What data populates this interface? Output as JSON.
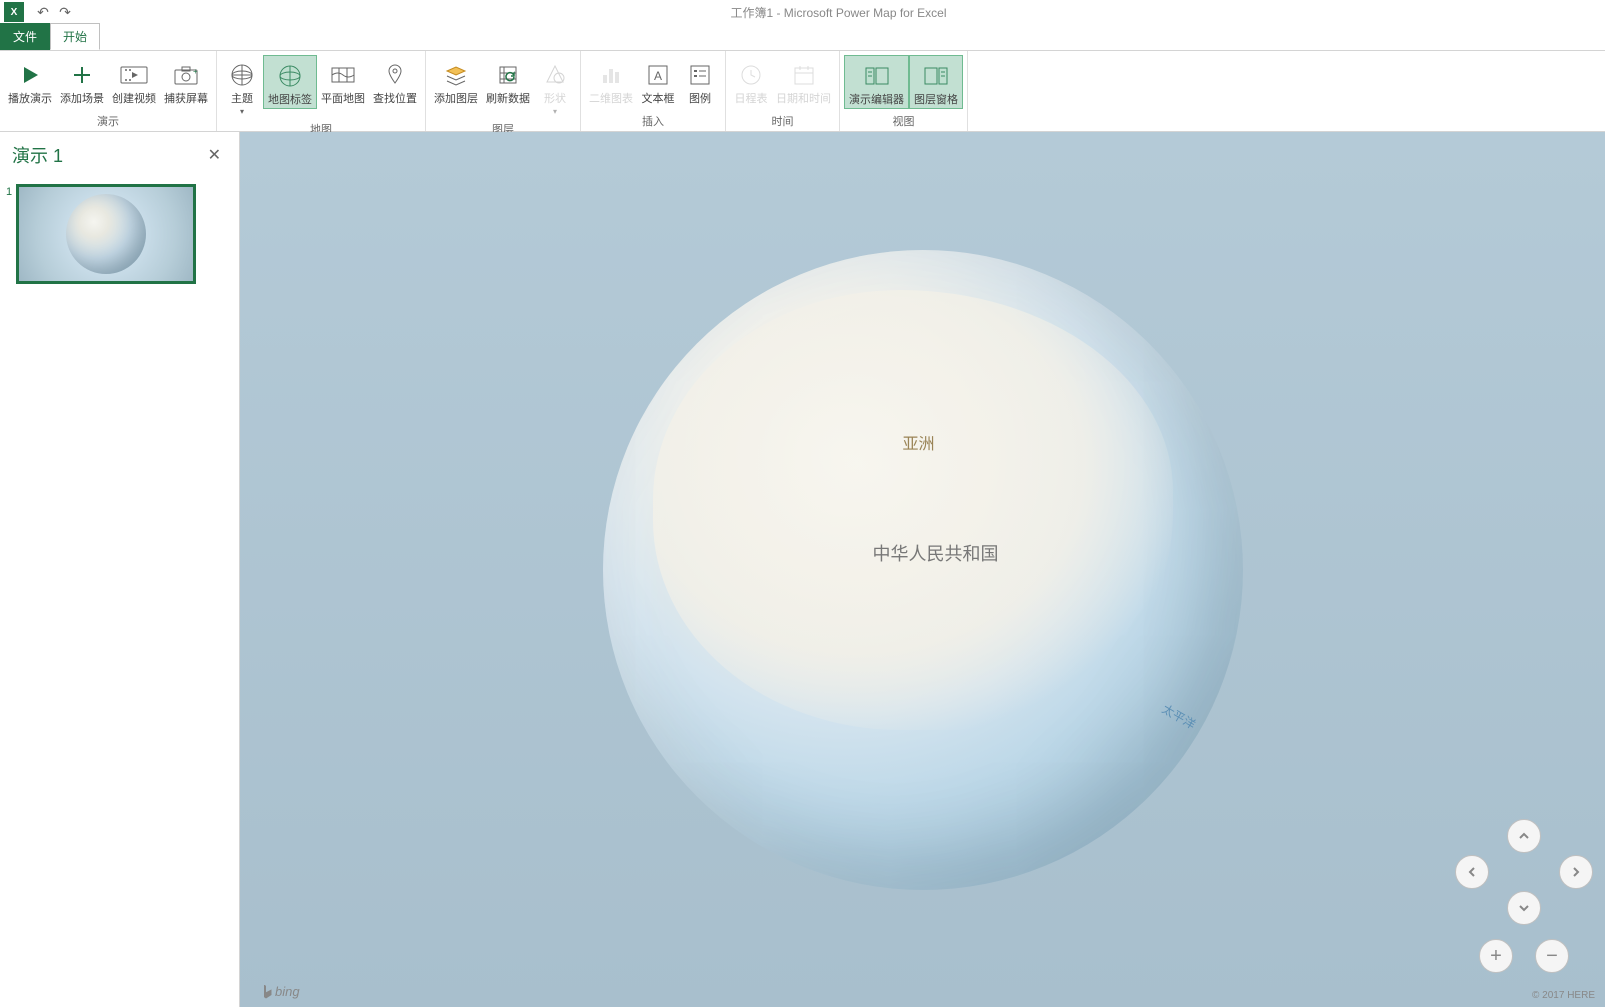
{
  "app": {
    "title": "工作簿1 - Microsoft Power Map for Excel",
    "iconText": "X",
    "qat": {
      "undo": "↶",
      "redo": "↷"
    }
  },
  "tabs": {
    "file": "文件",
    "start": "开始"
  },
  "ribbon": {
    "groups": {
      "demo": {
        "label": "演示",
        "play": "播放演示",
        "addScene": "添加场景",
        "createVideo": "创建视频",
        "capture": "捕获屏幕"
      },
      "map": {
        "label": "地图",
        "theme": "主题",
        "mapLabels": "地图标签",
        "flatMap": "平面地图",
        "findLocation": "查找位置"
      },
      "layer": {
        "label": "图层",
        "addLayer": "添加图层",
        "refreshData": "刷新数据",
        "shape": "形状"
      },
      "insert": {
        "label": "插入",
        "chart2d": "二维图表",
        "textbox": "文本框",
        "legend": "图例"
      },
      "time": {
        "label": "时间",
        "timeline": "日程表",
        "dateTime": "日期和时间"
      },
      "view": {
        "label": "视图",
        "tourEditor": "演示编辑器",
        "layerPane": "图层窗格"
      }
    }
  },
  "sidebar": {
    "title": "演示 1",
    "closeGlyph": "✕",
    "scenes": [
      {
        "num": "1"
      }
    ]
  },
  "mapView": {
    "labels": {
      "asia": "亚洲",
      "china": "中华人民共和国",
      "pacific": "太平洋"
    },
    "attribution": "bing",
    "copyright": "© 2017 HERE"
  },
  "nav": {
    "plus": "+",
    "minus": "−"
  }
}
